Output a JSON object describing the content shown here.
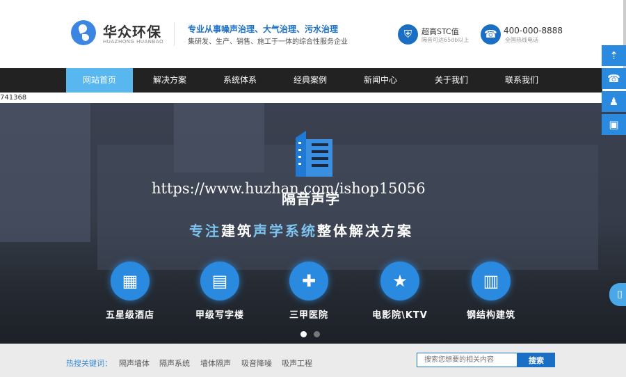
{
  "header": {
    "logo_cn": "华众环保",
    "logo_en": "HUAZHONG HUANBAO",
    "slogan_main": "专业从事噪声治理、大气治理、污水治理",
    "slogan_sub": "集研发、生产、销售、施工于一体的综合性服务企业",
    "stc_title": "超高STC值",
    "stc_sub": "隔音可达65db以上",
    "phone": "400-000-8888",
    "phone_sub": "全国热线电话"
  },
  "nav": [
    "网站首页",
    "解决方案",
    "系统体系",
    "经典案例",
    "新闻中心",
    "关于我们",
    "联系我们"
  ],
  "id_text": "741368",
  "banner": {
    "watermark": "https://www.huzhan.com/ishop15056",
    "brand": "隔音声学",
    "tagline_hl1": "专注",
    "tagline_1": "建筑",
    "tagline_hl2": "声学系统",
    "tagline_2": "整体解决方案",
    "categories": [
      {
        "label": "五星级酒店",
        "icon": "hotel-icon"
      },
      {
        "label": "甲级写字楼",
        "icon": "office-icon"
      },
      {
        "label": "三甲医院",
        "icon": "hospital-icon"
      },
      {
        "label": "电影院\\KTV",
        "icon": "cinema-icon"
      },
      {
        "label": "钢结构建筑",
        "icon": "building-icon"
      }
    ],
    "active_slide": 1,
    "slide_count": 2
  },
  "hot": {
    "label": "热搜关键词：",
    "keywords": [
      "隔声墙体",
      "隔声系统",
      "墙体隔声",
      "吸音降噪",
      "吸声工程"
    ],
    "search_placeholder": "搜索您想要的相关内容",
    "search_button": "搜索"
  },
  "colors": {
    "primary": "#1a6fc4",
    "nav_active": "#58b7ee",
    "nav_bg": "#222222"
  }
}
